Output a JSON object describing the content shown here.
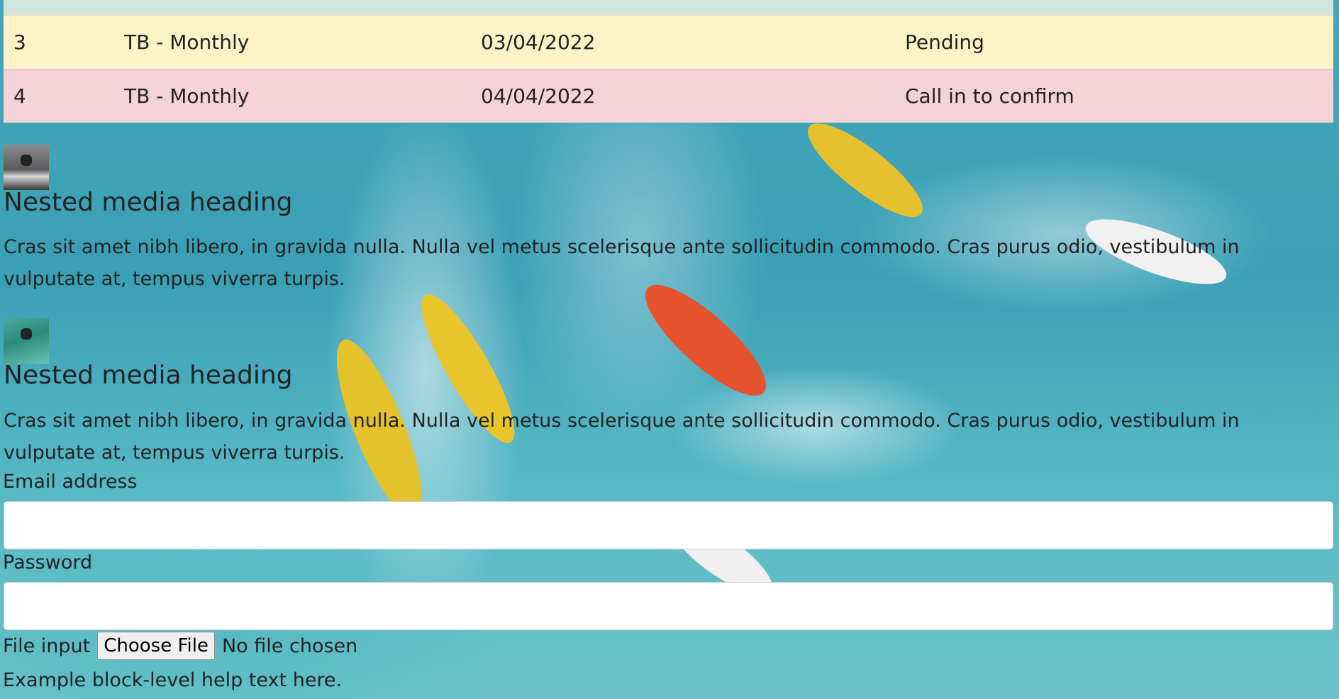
{
  "table": {
    "rows": [
      {
        "id": "3",
        "product": "TB - Monthly",
        "date": "03/04/2022",
        "status": "Pending",
        "state": "warning"
      },
      {
        "id": "4",
        "product": "TB - Monthly",
        "date": "04/04/2022",
        "status": "Call in to confirm",
        "state": "danger"
      }
    ]
  },
  "media": [
    {
      "heading": "Nested media heading",
      "body": "Cras sit amet nibh libero, in gravida nulla. Nulla vel metus scelerisque ante sollicitudin commodo. Cras purus odio, vestibulum in vulputate at, tempus viverra turpis.",
      "thumb_icon": "skateboarder-thumbnail"
    },
    {
      "heading": "Nested media heading",
      "body": "Cras sit amet nibh libero, in gravida nulla. Nulla vel metus scelerisque ante sollicitudin commodo. Cras purus odio, vestibulum in vulputate at, tempus viverra turpis.",
      "thumb_icon": "swimmer-thumbnail"
    }
  ],
  "form": {
    "email_label": "Email address",
    "email_value": "",
    "password_label": "Password",
    "password_value": "",
    "file_label": "File input",
    "file_button": "Choose File",
    "file_status": "No file chosen",
    "help_text": "Example block-level help text here."
  },
  "colors": {
    "warning_row": "#fef2c7",
    "danger_row": "#f3d3d8",
    "header_strip": "#cfe6dd"
  }
}
